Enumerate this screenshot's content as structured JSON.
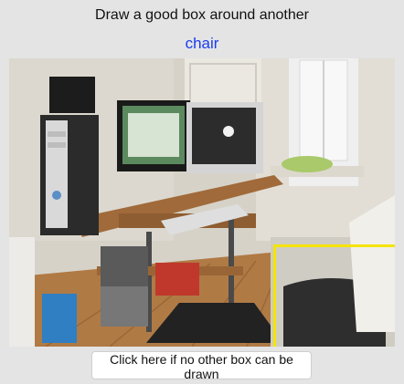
{
  "instruction": "Draw a good box around another",
  "target_label": "chair",
  "button_label": "Click here if no other box can be drawn",
  "colors": {
    "target_label": "#1a3cf0",
    "existing_box": "#f5e400"
  }
}
